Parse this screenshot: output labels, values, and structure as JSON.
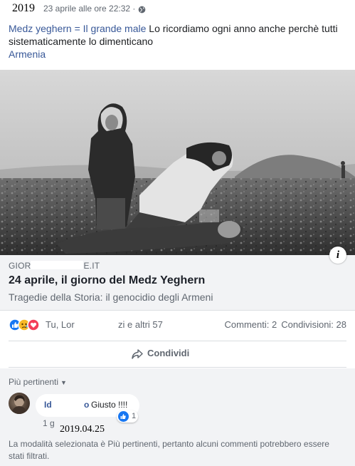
{
  "header": {
    "year_overlay": "2019",
    "timestamp": "23 aprile alle ore 22:32 ·",
    "privacy_icon": "globe-icon"
  },
  "post": {
    "text_link": "Medz yeghern = Il grande male",
    "text_body": " Lo ricordiamo ogni anno anche perchè tutti sistematicamente lo dimenticano",
    "place": "Armenia"
  },
  "photo": {
    "subject": "black-and-white-historic-photo"
  },
  "link_card": {
    "domain_start": "GIOR",
    "domain_end": "E.IT",
    "title": "24 aprile, il giorno del Medz Yeghern",
    "subtitle": "Tragedie della Storia: il genocidio degli Armeni",
    "info_label": "i"
  },
  "reactions": {
    "icons": [
      "like-icon",
      "sad-icon",
      "love-icon"
    ],
    "names": "Tu, Lor",
    "others": "zi e altri 57",
    "comments": "Commenti: 2",
    "shares": "Condivisioni: 28"
  },
  "actions": {
    "share_label": "Condividi"
  },
  "comments": {
    "sort_label": "Più pertinenti",
    "items": [
      {
        "author_start": "Id",
        "author_end": "o",
        "text": "Giusto !!!!",
        "likes": "1",
        "age": "1 g",
        "date_overlay": "2019.04.25"
      }
    ],
    "filter_notice": "La modalità selezionata è Più pertinenti, pertanto alcuni commenti potrebbero essere stati filtrati."
  },
  "colors": {
    "link": "#385898",
    "meta": "#606770",
    "like_blue": "#1877f2",
    "love_red": "#f33e58",
    "sad_yellow": "#f7b928",
    "card_bg": "#f2f3f5"
  }
}
